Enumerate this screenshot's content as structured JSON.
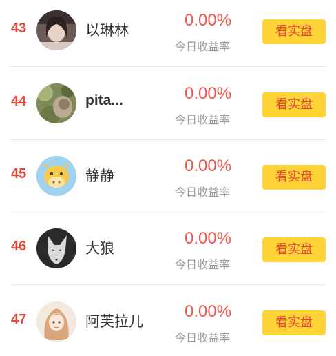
{
  "rows": [
    {
      "rank": "43",
      "name": "以琳林",
      "rate": "0.00%",
      "rate_label": "今日收益率",
      "button": "看实盘",
      "avatar": "woman-photo"
    },
    {
      "rank": "44",
      "name": "pita...",
      "rate": "0.00%",
      "rate_label": "今日收益率",
      "button": "看实盘",
      "avatar": "cat-photo"
    },
    {
      "rank": "45",
      "name": "静静",
      "rate": "0.00%",
      "rate_label": "今日收益率",
      "button": "看实盘",
      "avatar": "cartoon-cow"
    },
    {
      "rank": "46",
      "name": "大狼",
      "rate": "0.00%",
      "rate_label": "今日收益率",
      "button": "看实盘",
      "avatar": "wolf-photo"
    },
    {
      "rank": "47",
      "name": "阿芙拉儿",
      "rate": "0.00%",
      "rate_label": "今日收益率",
      "button": "看实盘",
      "avatar": "anime-girl"
    }
  ],
  "colors": {
    "rank": "#e5473b",
    "rate": "#f0574a",
    "button_bg": "#ffd437",
    "button_text": "#e5473b",
    "label": "#9b9b9b"
  }
}
